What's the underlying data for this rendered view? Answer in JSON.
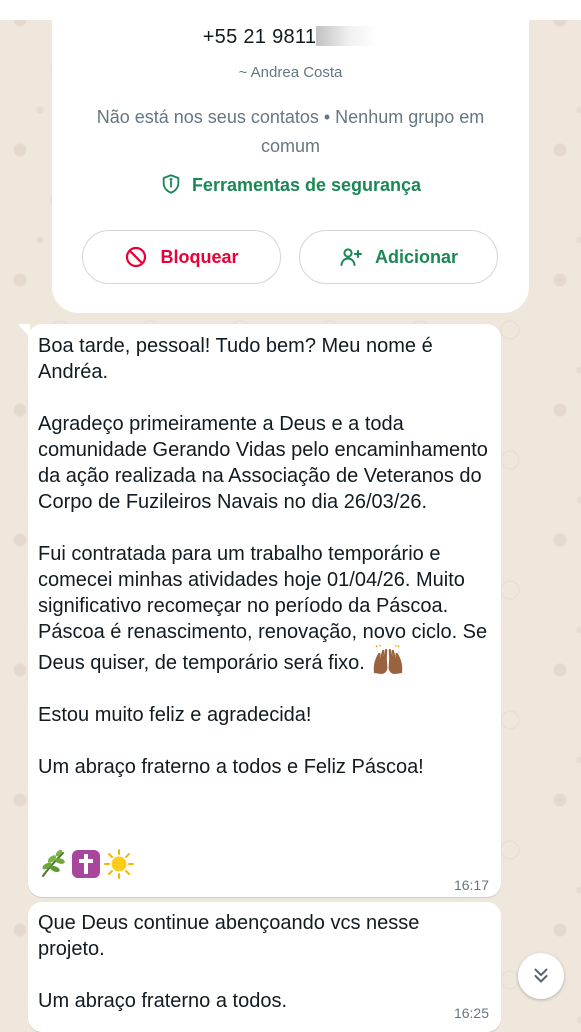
{
  "contact_card": {
    "phone": "+55 21 9811",
    "pushname": "~ Andrea Costa",
    "status_text": "Não está nos seus contatos • Nenhum grupo em comum",
    "safety_tools_label": "Ferramentas de segurança",
    "block_label": "Bloquear",
    "add_label": "Adicionar"
  },
  "messages": [
    {
      "text": "Boa tarde, pessoal! Tudo bem? Meu nome é Andréa.\n\nAgradeço primeiramente a Deus e a toda comunidade Gerando Vidas pelo encaminhamento da ação realizada na Associação de Veteranos do Corpo de Fuzileiros Navais no dia 26/03/26.\n\nFui contratada para um trabalho temporário e comecei minhas atividades hoje 01/04/26. Muito significativo recomeçar no período da Páscoa. Páscoa é renascimento, renovação, novo ciclo. Se Deus quiser, de temporário será fixo.",
      "text_after_emoji": "\n\nEstou muito feliz e agradecida!\n\nUm abraço fraterno a todos e Feliz Páscoa!",
      "inline_emoji": "raising-hands-emoji",
      "trailing_emojis": [
        "herb-emoji",
        "latin-cross-emoji",
        "sun-emoji"
      ],
      "time": "16:17"
    },
    {
      "text": "Que Deus continue abençoando vcs nesse projeto.\n\nUm abraço fraterno a todos.",
      "time": "16:25"
    }
  ],
  "icons": {
    "safety": "shield-icon",
    "block": "block-icon",
    "add": "add-person-icon",
    "scroll": "double-chevron-down-icon"
  },
  "colors": {
    "accent_green": "#1b8755",
    "danger_red": "#ea0038",
    "wallpaper": "#efe7dc",
    "bubble": "#ffffff",
    "muted_text": "#667781"
  }
}
